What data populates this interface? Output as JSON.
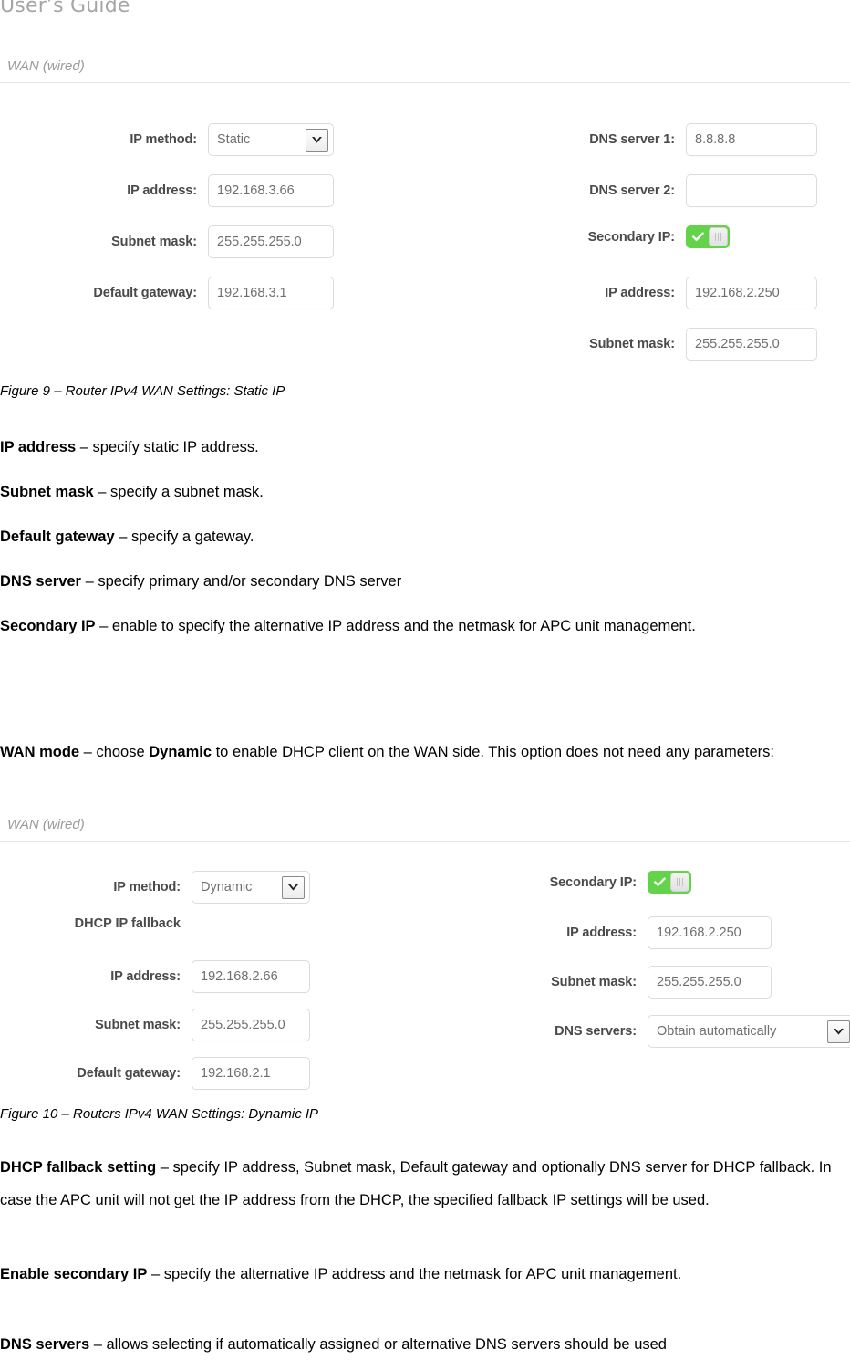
{
  "header": {
    "title": "User’s Guide"
  },
  "figure_static": {
    "panel_title": "WAN (wired)",
    "left_fields": [
      {
        "label": "IP method:",
        "type": "select",
        "value": "Static",
        "name": "ip-method"
      },
      {
        "label": "IP address:",
        "type": "text",
        "value": "192.168.3.66",
        "name": "ip-address"
      },
      {
        "label": "Subnet mask:",
        "type": "text",
        "value": "255.255.255.0",
        "name": "subnet-mask"
      },
      {
        "label": "Default gateway:",
        "type": "text",
        "value": "192.168.3.1",
        "name": "default-gateway"
      }
    ],
    "right_fields": [
      {
        "label": "DNS server 1:",
        "type": "text",
        "value": "8.8.8.8",
        "name": "dns-server-1"
      },
      {
        "label": "DNS server 2:",
        "type": "text",
        "value": "",
        "name": "dns-server-2"
      },
      {
        "label": "Secondary IP:",
        "type": "toggle",
        "value": "on",
        "name": "secondary-ip-toggle"
      },
      {
        "label": "IP address:",
        "type": "text",
        "value": "192.168.2.250",
        "name": "secondary-ip-address"
      },
      {
        "label": "Subnet mask:",
        "type": "text",
        "value": "255.255.255.0",
        "name": "secondary-subnet-mask"
      }
    ],
    "caption": "Figure 9 – Router IPv4 WAN Settings: Static IP"
  },
  "figure_dynamic": {
    "panel_title": "WAN (wired)",
    "left_fields": [
      {
        "label": "IP method:",
        "type": "select",
        "value": "Dynamic",
        "name": "ip-method"
      },
      {
        "label": "DHCP IP fallback",
        "type": "plain",
        "value": "",
        "name": "dhcp-ip-fallback-heading"
      },
      {
        "label": "IP address:",
        "type": "text",
        "value": "192.168.2.66",
        "name": "fallback-ip-address"
      },
      {
        "label": "Subnet mask:",
        "type": "text",
        "value": "255.255.255.0",
        "name": "fallback-subnet-mask"
      },
      {
        "label": "Default gateway:",
        "type": "text",
        "value": "192.168.2.1",
        "name": "fallback-default-gateway"
      }
    ],
    "right_fields": [
      {
        "label": "Secondary IP:",
        "type": "toggle",
        "value": "on",
        "name": "secondary-ip-toggle"
      },
      {
        "label": "IP address:",
        "type": "text",
        "value": "192.168.2.250",
        "name": "secondary-ip-address"
      },
      {
        "label": "Subnet mask:",
        "type": "text",
        "value": "255.255.255.0",
        "name": "secondary-subnet-mask"
      },
      {
        "label": "DNS servers:",
        "type": "select",
        "value": "Obtain automatically",
        "name": "dns-servers"
      }
    ],
    "caption": "Figure 10 – Routers IPv4 WAN Settings: Dynamic IP"
  },
  "body": {
    "p1_term": "IP address",
    "p1_rest": " – specify static IP address.",
    "p2_term": "Subnet mask",
    "p2_rest": " – specify a subnet mask.",
    "p3_term": "Default gateway",
    "p3_rest": " – specify a gateway.",
    "p4_term": "DNS server",
    "p4_rest": " – specify primary and/or secondary DNS server",
    "p5_term": "Secondary IP",
    "p5_rest": " – enable to specify the alternative IP address and the netmask for APC unit management.",
    "p6_term": "WAN mode",
    "p6_mid": " – choose ",
    "p6_bold2": "Dynamic",
    "p6_rest": " to enable DHCP client on the WAN side. This option does not need any parameters:",
    "p7_term": "DHCP fallback setting",
    "p7_rest": " – specify IP address, Subnet mask, Default gateway and optionally DNS server for DHCP fallback. In case the APC unit will not get the IP address from the DHCP, the specified fallback IP settings will be used.",
    "p8_term": "Enable secondary IP",
    "p8_rest": " – specify the alternative IP address and the netmask for APC unit management.",
    "p9_term": "DNS servers",
    "p9_rest": " – allows selecting if automatically assigned or alternative DNS servers should be used"
  },
  "colors": {
    "toggle_on": "#63d44a",
    "panel_title": "#9b9b9b",
    "label": "#4a4a4a",
    "input_text": "#6f6f6f",
    "border": "#dcdcdc"
  }
}
